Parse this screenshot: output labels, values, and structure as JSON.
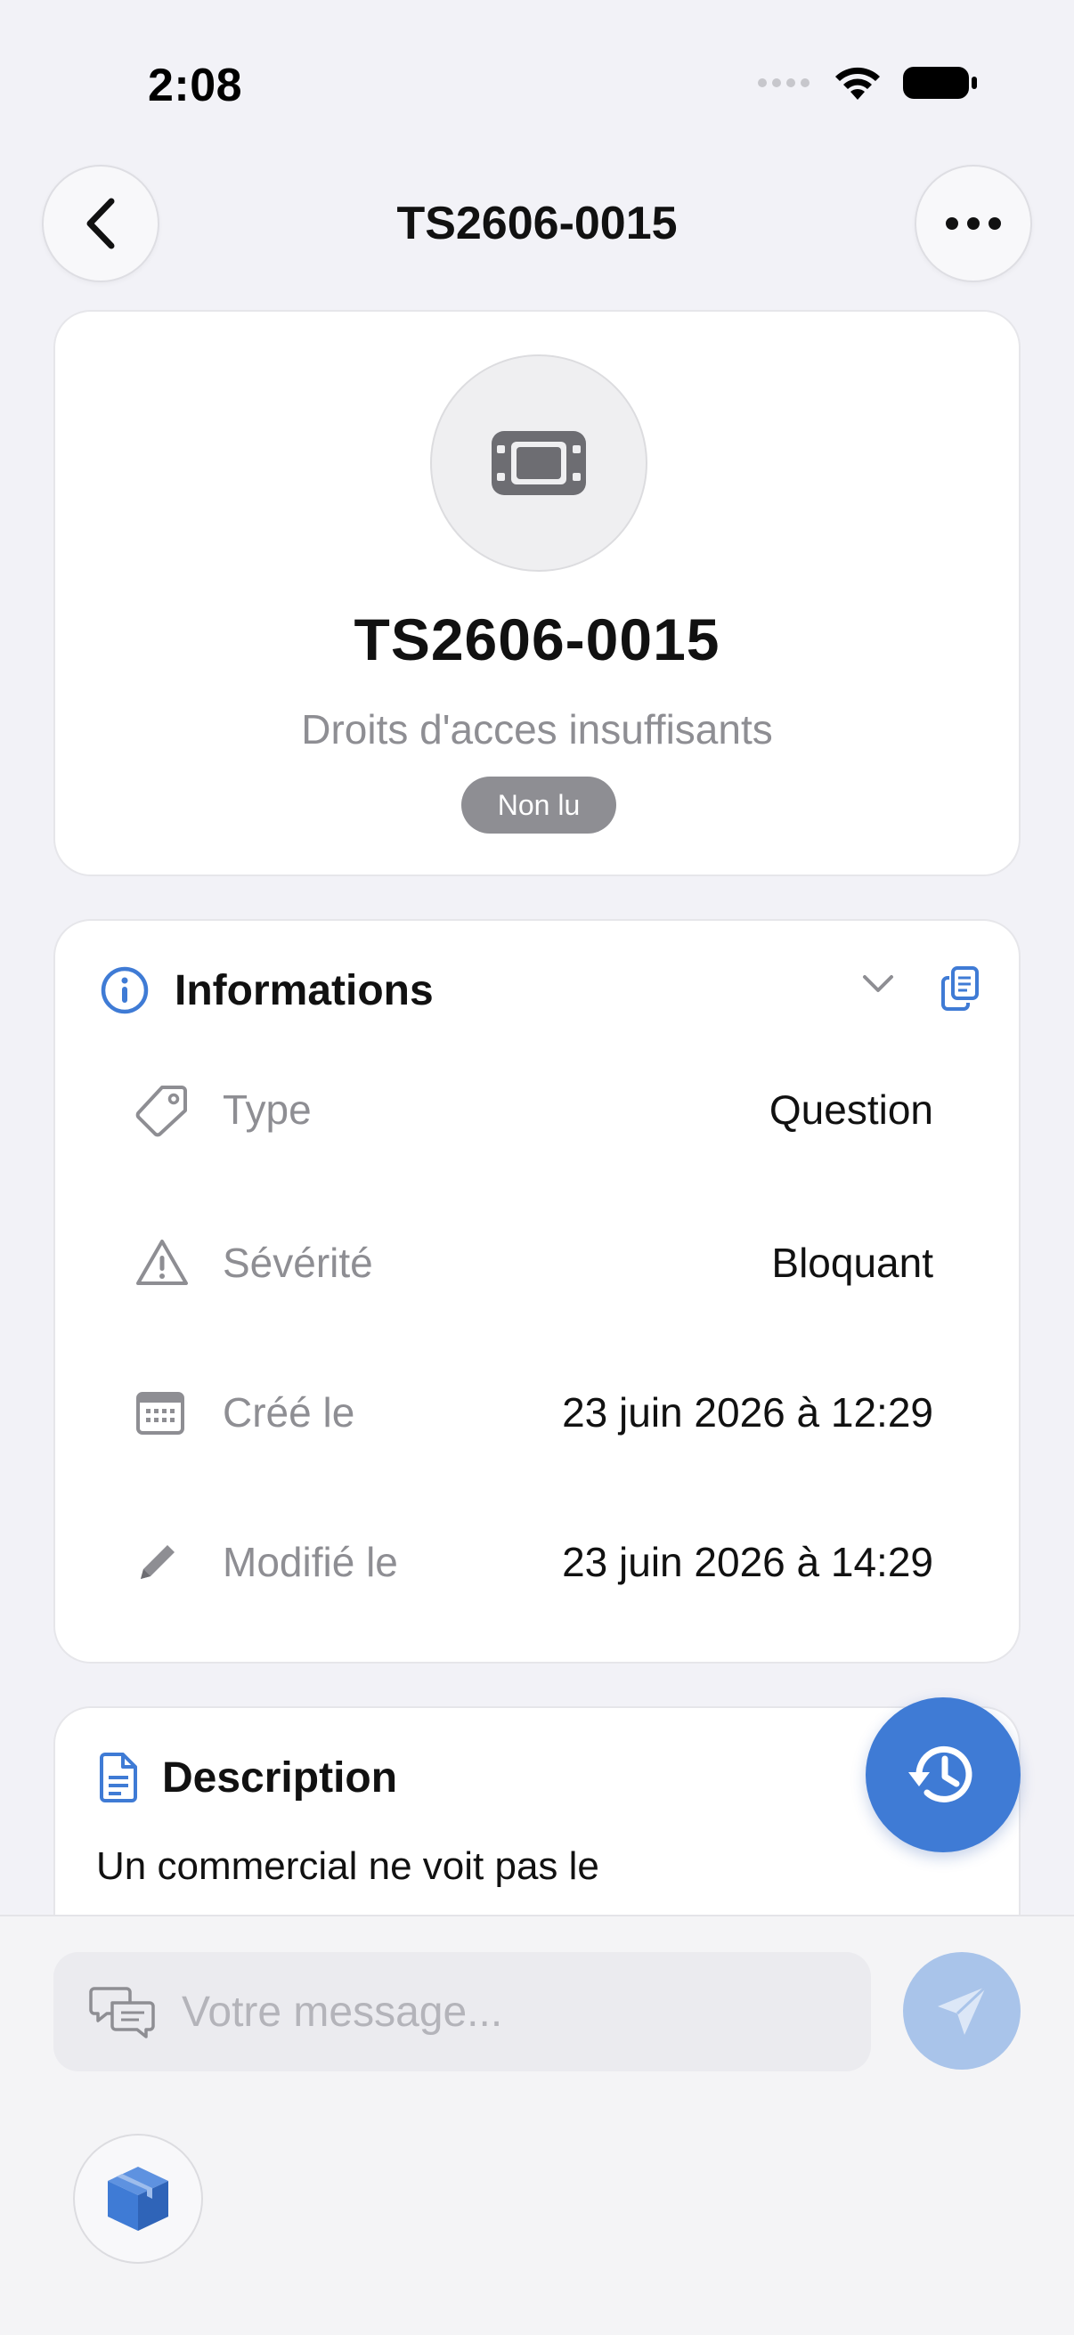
{
  "status_bar": {
    "time": "2:08"
  },
  "nav": {
    "title": "TS2606-0015"
  },
  "hero": {
    "title": "TS2606-0015",
    "subtitle": "Droits d'acces insuffisants",
    "badge": "Non lu"
  },
  "info": {
    "title": "Informations",
    "rows": [
      {
        "label": "Type",
        "value": "Question",
        "icon": "tag-icon"
      },
      {
        "label": "Sévérité",
        "value": "Bloquant",
        "icon": "warning-icon"
      },
      {
        "label": "Créé le",
        "value": "23 juin 2026 à 12:29",
        "icon": "calendar-icon"
      },
      {
        "label": "Modifié le",
        "value": "23 juin 2026 à 14:29",
        "icon": "pencil-icon"
      }
    ]
  },
  "description": {
    "title": "Description",
    "text": "Un commercial ne voit pas le"
  },
  "composer": {
    "placeholder": "Votre message..."
  },
  "colors": {
    "accent": "#3f7bd5",
    "badge": "#8e8e93",
    "background": "#f2f2f7"
  }
}
